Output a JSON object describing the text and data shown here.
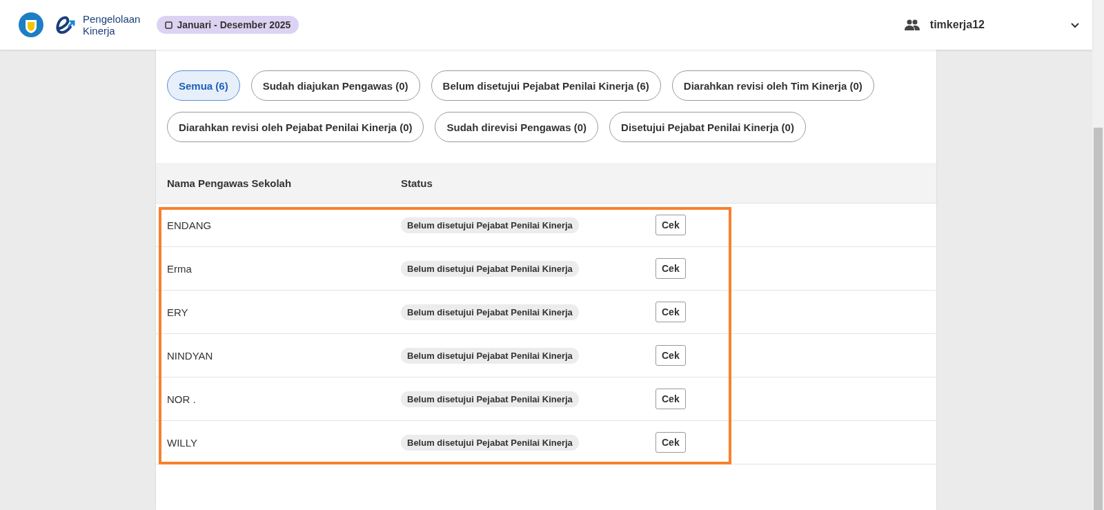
{
  "header": {
    "app_name_line1": "Pengelolaan",
    "app_name_line2": "Kinerja",
    "period": "Januari - Desember 2025",
    "user": "timkerja12"
  },
  "filters": [
    {
      "label": "Semua (6)",
      "selected": true
    },
    {
      "label": "Sudah diajukan Pengawas (0)",
      "selected": false
    },
    {
      "label": "Belum disetujui Pejabat Penilai Kinerja (6)",
      "selected": false
    },
    {
      "label": "Diarahkan revisi oleh Tim Kinerja (0)",
      "selected": false
    },
    {
      "label": "Diarahkan revisi oleh Pejabat Penilai Kinerja (0)",
      "selected": false
    },
    {
      "label": "Sudah direvisi Pengawas (0)",
      "selected": false
    },
    {
      "label": "Disetujui Pejabat Penilai Kinerja (0)",
      "selected": false
    }
  ],
  "table": {
    "columns": [
      "Nama Pengawas Sekolah",
      "Status"
    ],
    "rows": [
      {
        "name": "ENDANG",
        "status": "Belum disetujui Pejabat Penilai Kinerja",
        "action": "Cek"
      },
      {
        "name": "Erma",
        "status": "Belum disetujui Pejabat Penilai Kinerja",
        "action": "Cek"
      },
      {
        "name": "ERY",
        "status": "Belum disetujui Pejabat Penilai Kinerja",
        "action": "Cek"
      },
      {
        "name": "NINDYAN",
        "status": "Belum disetujui Pejabat Penilai Kinerja",
        "action": "Cek"
      },
      {
        "name": "NOR .",
        "status": "Belum disetujui Pejabat Penilai Kinerja",
        "action": "Cek"
      },
      {
        "name": "WILLY",
        "status": "Belum disetujui Pejabat Penilai Kinerja",
        "action": "Cek"
      }
    ]
  }
}
